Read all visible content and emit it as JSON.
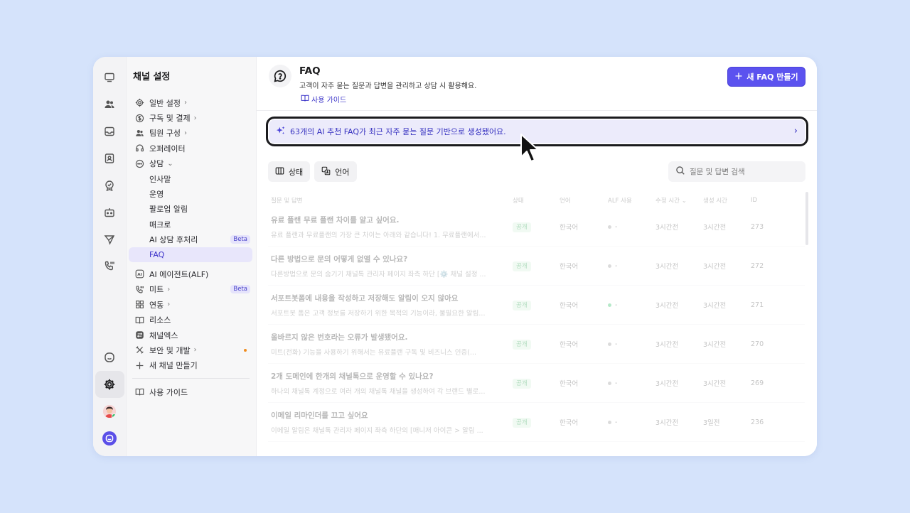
{
  "colors": {
    "accent": "#5b52ef",
    "page_bg": "#d5e3fb",
    "banner_bg": "#ecebfb"
  },
  "rail": {
    "icons": [
      "monitor-icon",
      "users-icon",
      "inbox-icon",
      "contact-icon",
      "badge-check-icon",
      "bot-icon",
      "send-icon",
      "phone-icon",
      "chat-icon",
      "gear-icon",
      "avatar",
      "brand-logo-icon"
    ]
  },
  "settings": {
    "title": "채널 설정",
    "items": [
      {
        "label": "일반 설정",
        "icon": "gear-icon",
        "chevron": true
      },
      {
        "label": "구독 및 결제",
        "icon": "dollar-icon",
        "chevron": true
      },
      {
        "label": "팀원 구성",
        "icon": "team-icon",
        "chevron": true
      },
      {
        "label": "오퍼레이터",
        "icon": "headset-icon"
      },
      {
        "label": "상담",
        "icon": "chat-dots-icon",
        "expanded": true
      }
    ],
    "sub_items": [
      {
        "label": "인사말"
      },
      {
        "label": "운영"
      },
      {
        "label": "팔로업 알림"
      },
      {
        "label": "매크로"
      },
      {
        "label": "AI 상담 후처리",
        "badge": "Beta"
      },
      {
        "label": "FAQ",
        "active": true
      }
    ],
    "items2": [
      {
        "label": "AI 에이전트(ALF)",
        "icon": "ai-icon"
      },
      {
        "label": "미트",
        "icon": "phone-icon",
        "chevron": true,
        "badge": "Beta"
      },
      {
        "label": "연동",
        "icon": "grid-icon",
        "chevron": true
      },
      {
        "label": "리소스",
        "icon": "book-icon"
      },
      {
        "label": "채널엑스",
        "icon": "channelx-icon"
      },
      {
        "label": "보안 및 개발",
        "icon": "tools-icon",
        "chevron": true,
        "dot": true
      },
      {
        "label": "새 채널 만들기",
        "icon": "plus-icon"
      }
    ],
    "guide_label": "사용 가이드"
  },
  "header": {
    "title": "FAQ",
    "description": "고객이 자주 묻는 질문과 답변을 관리하고 상담 시 활용해요.",
    "guide_link": "사용 가이드",
    "new_button": "새 FAQ 만들기"
  },
  "banner": {
    "text": "63개의 AI 추천 FAQ가 최근 자주 묻는 질문 기반으로 생성됐어요."
  },
  "filters": {
    "status": "상태",
    "language": "언어"
  },
  "search": {
    "placeholder": "질문 및 답변 검색"
  },
  "table": {
    "columns": [
      "질문 및 답변",
      "상태",
      "언어",
      "ALF 사용",
      "수정 시간",
      "생성 시간",
      "ID"
    ],
    "rows": [
      {
        "title": "유료 플랜 무료 플랜 차이를 알고 싶어요.",
        "answer": "유료 플랜과 무료플랜의 가장 큰 차이는 아래와 같습니다! 1. 무료플랜에서...",
        "status": "공개",
        "lang": "한국어",
        "alf": "-",
        "alf_on": false,
        "modified": "3시간전",
        "created": "3시간전",
        "id": "273"
      },
      {
        "title": "다른 방법으로 문의 어떻게 없앨 수 있나요?",
        "answer": "다른방법으로 문의 숨기기 채널톡 관리자 페이지 좌측 하단 [⚙️ 채널 설정 ...",
        "status": "공개",
        "lang": "한국어",
        "alf": "-",
        "alf_on": false,
        "modified": "3시간전",
        "created": "3시간전",
        "id": "272"
      },
      {
        "title": "서포트봇폼에 내용을 작성하고 저장해도 알림이 오지 않아요",
        "answer": "서포트봇 폼은 고객 정보를 저장하기 위한 목적의 기능이라, 불필요한 알림...",
        "status": "공개",
        "lang": "한국어",
        "alf": "-",
        "alf_on": true,
        "modified": "3시간전",
        "created": "3시간전",
        "id": "271"
      },
      {
        "title": "올바르지 않은 번호라는 오류가 발생됐어요.",
        "answer": "미트(전화) 기능을 사용하기 위해서는 유료플랜 구독 및 비즈니스 인증(...",
        "status": "공개",
        "lang": "한국어",
        "alf": "-",
        "alf_on": false,
        "modified": "3시간전",
        "created": "3시간전",
        "id": "270"
      },
      {
        "title": "2개 도메인에 한개의 채널톡으로 운영할 수 있나요?",
        "answer": "하나의 채널톡 계정으로 여러 개의 채널톡 채널을 생성하여 각 브랜드 별로...",
        "status": "공개",
        "lang": "한국어",
        "alf": "-",
        "alf_on": false,
        "modified": "3시간전",
        "created": "3시간전",
        "id": "269"
      },
      {
        "title": "이메일 리마인더를 끄고 싶어요",
        "answer": "이메일 알림은 채널톡 관리자 페이지 좌측 하단의 [매니저 아이콘 > 알림 ...",
        "status": "공개",
        "lang": "한국어",
        "alf": "-",
        "alf_on": false,
        "modified": "3시간전",
        "created": "3일전",
        "id": "236"
      }
    ]
  }
}
